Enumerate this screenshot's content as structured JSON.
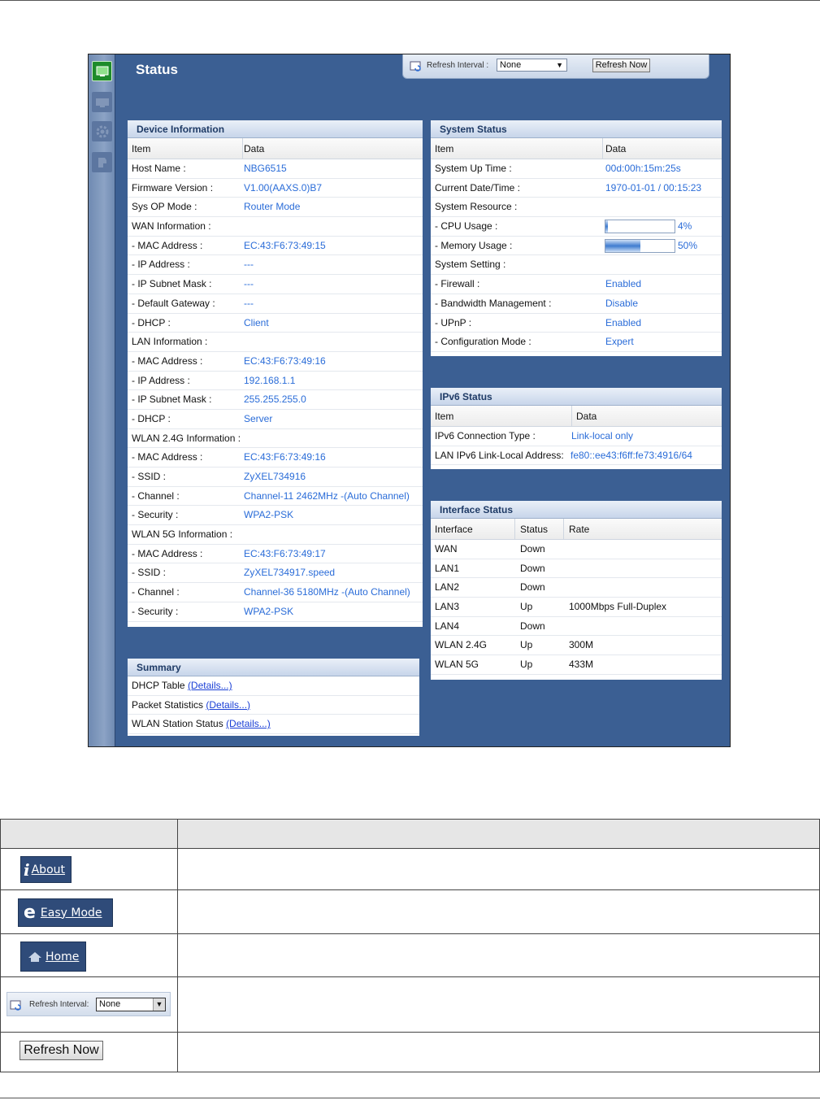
{
  "page": {
    "title": "Status"
  },
  "refresh": {
    "label": "Refresh Interval :",
    "interval": "None",
    "refresh_now": "Refresh Now"
  },
  "device_info": {
    "title": "Device Information",
    "col_item": "Item",
    "col_data": "Data",
    "rows": [
      {
        "item": "Host Name :",
        "data": "NBG6515"
      },
      {
        "item": "Firmware Version :",
        "data": "V1.00(AAXS.0)B7"
      },
      {
        "item": "Sys OP Mode :",
        "data": "Router Mode"
      },
      {
        "item": "WAN Information :",
        "data": ""
      },
      {
        "item": "  - MAC Address :",
        "data": "EC:43:F6:73:49:15"
      },
      {
        "item": "  - IP Address :",
        "data": "---"
      },
      {
        "item": "  - IP Subnet Mask :",
        "data": "---"
      },
      {
        "item": "  - Default Gateway :",
        "data": "---"
      },
      {
        "item": "  - DHCP :",
        "data": "Client"
      },
      {
        "item": "LAN Information :",
        "data": ""
      },
      {
        "item": "  - MAC Address :",
        "data": "EC:43:F6:73:49:16"
      },
      {
        "item": "  - IP Address :",
        "data": "192.168.1.1"
      },
      {
        "item": "  - IP Subnet Mask :",
        "data": "255.255.255.0"
      },
      {
        "item": "  - DHCP :",
        "data": "Server"
      },
      {
        "item": "WLAN 2.4G Information :",
        "data": ""
      },
      {
        "item": "  - MAC Address :",
        "data": "EC:43:F6:73:49:16"
      },
      {
        "item": "  - SSID :",
        "data": "ZyXEL734916"
      },
      {
        "item": "  - Channel :",
        "data": "Channel-11 2462MHz -(Auto Channel)"
      },
      {
        "item": "  - Security :",
        "data": "WPA2-PSK"
      },
      {
        "item": "WLAN 5G Information :",
        "data": ""
      },
      {
        "item": "  - MAC Address :",
        "data": "EC:43:F6:73:49:17"
      },
      {
        "item": "  - SSID :",
        "data": "ZyXEL734917.speed"
      },
      {
        "item": "  - Channel :",
        "data": "Channel-36 5180MHz -(Auto Channel)"
      },
      {
        "item": "  - Security :",
        "data": "WPA2-PSK"
      }
    ]
  },
  "system_status": {
    "title": "System Status",
    "col_item": "Item",
    "col_data": "Data",
    "rows": [
      {
        "item": "System Up Time :",
        "data": "00d:00h:15m:25s"
      },
      {
        "item": "Current Date/Time :",
        "data": "1970-01-01 / 00:15:23"
      },
      {
        "item": "System Resource :",
        "data": ""
      },
      {
        "item": "  - CPU Usage :",
        "data": "4%",
        "usage": 4
      },
      {
        "item": "  - Memory Usage :",
        "data": "50%",
        "usage": 50
      },
      {
        "item": "System Setting :",
        "data": ""
      },
      {
        "item": "  - Firewall :",
        "data": "Enabled"
      },
      {
        "item": "  - Bandwidth Management :",
        "data": "Disable"
      },
      {
        "item": "  - UPnP :",
        "data": "Enabled"
      },
      {
        "item": "  - Configuration Mode :",
        "data": "Expert"
      }
    ]
  },
  "ipv6_status": {
    "title": "IPv6 Status",
    "col_item": "Item",
    "col_data": "Data",
    "rows": [
      {
        "item": "IPv6 Connection Type :",
        "data": "Link-local only"
      },
      {
        "item": "LAN IPv6 Link-Local Address:",
        "data": "fe80::ee43:f6ff:fe73:4916/64"
      }
    ]
  },
  "interface_status": {
    "title": "Interface Status",
    "col_interface": "Interface",
    "col_status": "Status",
    "col_rate": "Rate",
    "rows": [
      {
        "interface": "WAN",
        "status": "Down",
        "rate": ""
      },
      {
        "interface": "LAN1",
        "status": "Down",
        "rate": ""
      },
      {
        "interface": "LAN2",
        "status": "Down",
        "rate": ""
      },
      {
        "interface": "LAN3",
        "status": "Up",
        "rate": "1000Mbps Full-Duplex"
      },
      {
        "interface": "LAN4",
        "status": "Down",
        "rate": ""
      },
      {
        "interface": "WLAN 2.4G",
        "status": "Up",
        "rate": "300M"
      },
      {
        "interface": "WLAN 5G",
        "status": "Up",
        "rate": "433M"
      }
    ]
  },
  "summary": {
    "title": "Summary",
    "rows": [
      {
        "label": "DHCP Table",
        "link": "(Details...)"
      },
      {
        "label": "Packet Statistics",
        "link": "(Details...)"
      },
      {
        "label": "WLAN Station Status",
        "link": "(Details...)"
      }
    ]
  },
  "reference": {
    "about_label": "About",
    "about_glyph": "i",
    "easy_mode_label": "Easy Mode",
    "easy_glyph": "e",
    "home_label": "Home",
    "refresh_label": "Refresh Interval:",
    "refresh_value": "None",
    "refresh_now_label": "Refresh Now"
  },
  "colors": {
    "frame_bg": "#3b5f93",
    "link": "#2a6cd8",
    "panel_head": "#1f3b66"
  }
}
